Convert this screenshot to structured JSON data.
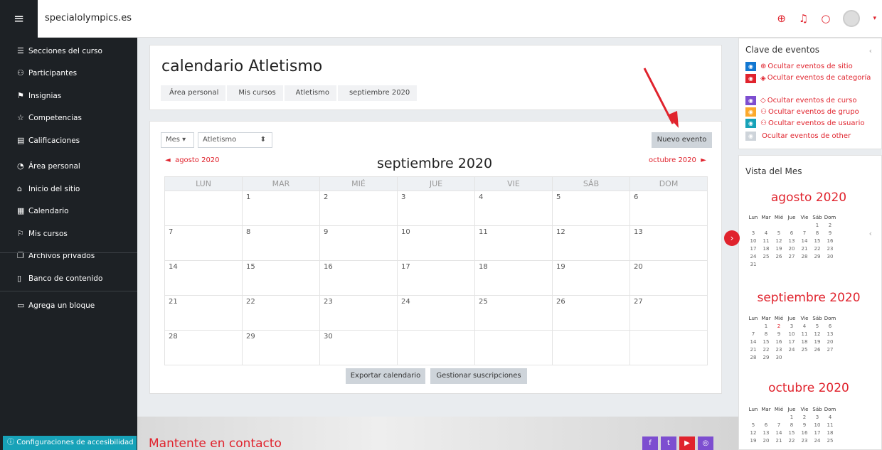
{
  "navbar": {
    "site_name": "specialolympics.es",
    "menu_icon": "hamburger-icon"
  },
  "sidebar": {
    "items": [
      {
        "label": "Secciones del curso",
        "icon": "list-icon",
        "glyph": "☰"
      },
      {
        "label": "Participantes",
        "icon": "users-icon",
        "glyph": "⚇"
      },
      {
        "label": "Insignias",
        "icon": "badge-icon",
        "glyph": "⚑"
      },
      {
        "label": "Competencias",
        "icon": "star-icon",
        "glyph": "☆"
      },
      {
        "label": "Calificaciones",
        "icon": "grades-icon",
        "glyph": "▤"
      },
      {
        "label": "Área personal",
        "icon": "dashboard-icon",
        "glyph": "◔"
      },
      {
        "label": "Inicio del sitio",
        "icon": "home-icon",
        "glyph": "⌂"
      },
      {
        "label": "Calendario",
        "icon": "calendar-icon",
        "glyph": "▦"
      },
      {
        "label": "Mis cursos",
        "icon": "graduation-cap-icon",
        "glyph": "⚐"
      },
      {
        "label": "Archivos privados",
        "icon": "files-icon",
        "glyph": "❐"
      },
      {
        "label": "Banco de contenido",
        "icon": "clipboard-icon",
        "glyph": "▯"
      },
      {
        "label": "Agrega un bloque",
        "icon": "folder-icon",
        "glyph": "▭"
      }
    ],
    "accessibility": "Configuraciones de accesibilidad"
  },
  "header": {
    "title": "calendario Atletismo",
    "breadcrumb": [
      "Área personal",
      "Mis cursos",
      "Atletismo",
      "septiembre 2020"
    ]
  },
  "calendar": {
    "view_select": "Mes",
    "course_select": "Atletismo",
    "new_event": "Nuevo evento",
    "prev_month": "agosto 2020",
    "next_month": "octubre 2020",
    "month_title": "septiembre 2020",
    "weekdays": [
      "LUN",
      "MAR",
      "MIÉ",
      "JUE",
      "VIE",
      "SÁB",
      "DOM"
    ],
    "weeks": [
      [
        "",
        "1",
        "2",
        "3",
        "4",
        "5",
        "6"
      ],
      [
        "7",
        "8",
        "9",
        "10",
        "11",
        "12",
        "13"
      ],
      [
        "14",
        "15",
        "16",
        "17",
        "18",
        "19",
        "20"
      ],
      [
        "21",
        "22",
        "23",
        "24",
        "25",
        "26",
        "27"
      ],
      [
        "28",
        "29",
        "30",
        "",
        "",
        "",
        ""
      ]
    ],
    "export": "Exportar calendario",
    "manage": "Gestionar suscripciones"
  },
  "footer": {
    "title": "Mantente en contacto"
  },
  "event_key": {
    "title": "Clave de eventos",
    "items": [
      {
        "label": "Ocultar eventos de sitio",
        "color": "#1177d1",
        "glyph": "⊕"
      },
      {
        "label": "Ocultar eventos de categoría",
        "color": "#e0232d",
        "glyph": "◈"
      },
      {
        "label": "Ocultar eventos de curso",
        "color": "#7d4ed0",
        "glyph": "◇"
      },
      {
        "label": "Ocultar eventos de grupo",
        "color": "#fba92c",
        "glyph": "⚇"
      },
      {
        "label": "Ocultar eventos de usuario",
        "color": "#17a2b8",
        "glyph": "⚇"
      },
      {
        "label": "Ocultar eventos de other",
        "color": "#ced4da",
        "glyph": ""
      }
    ]
  },
  "month_view": {
    "title": "Vista del Mes",
    "days": [
      "Lun",
      "Mar",
      "Mié",
      "Jue",
      "Vie",
      "Sáb",
      "Dom"
    ],
    "months": [
      {
        "name": "agosto 2020",
        "weeks": [
          [
            "",
            "",
            "",
            "",
            "",
            "1",
            "2"
          ],
          [
            "3",
            "4",
            "5",
            "6",
            "7",
            "8",
            "9"
          ],
          [
            "10",
            "11",
            "12",
            "13",
            "14",
            "15",
            "16"
          ],
          [
            "17",
            "18",
            "19",
            "20",
            "21",
            "22",
            "23"
          ],
          [
            "24",
            "25",
            "26",
            "27",
            "28",
            "29",
            "30"
          ],
          [
            "31",
            "",
            "",
            "",
            "",
            "",
            ""
          ]
        ]
      },
      {
        "name": "septiembre 2020",
        "weeks": [
          [
            "",
            "1",
            "2",
            "3",
            "4",
            "5",
            "6"
          ],
          [
            "7",
            "8",
            "9",
            "10",
            "11",
            "12",
            "13"
          ],
          [
            "14",
            "15",
            "16",
            "17",
            "18",
            "19",
            "20"
          ],
          [
            "21",
            "22",
            "23",
            "24",
            "25",
            "26",
            "27"
          ],
          [
            "28",
            "29",
            "30",
            "",
            "",
            "",
            ""
          ]
        ]
      },
      {
        "name": "octubre 2020",
        "weeks": [
          [
            "",
            "",
            "",
            "1",
            "2",
            "3",
            "4"
          ],
          [
            "5",
            "6",
            "7",
            "8",
            "9",
            "10",
            "11"
          ],
          [
            "12",
            "13",
            "14",
            "15",
            "16",
            "17",
            "18"
          ],
          [
            "19",
            "20",
            "21",
            "22",
            "23",
            "24",
            "25"
          ]
        ]
      }
    ]
  }
}
